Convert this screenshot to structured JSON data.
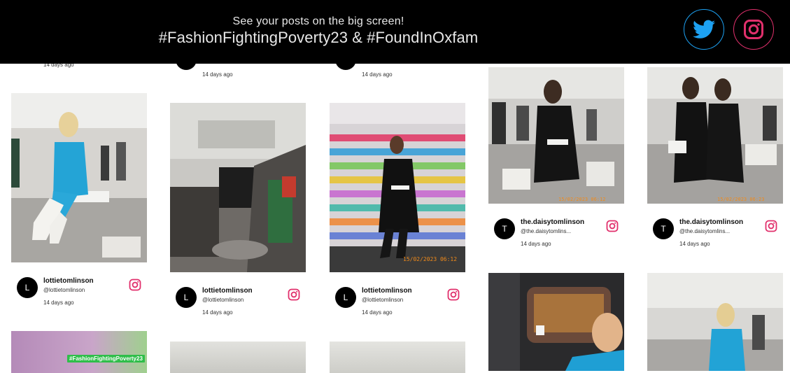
{
  "header": {
    "tagline": "See your posts on the big screen!",
    "hashtags": "#FashionFightingPoverty23 & #FoundInOxfam",
    "twitter_icon": "twitter-icon",
    "instagram_icon": "instagram-icon",
    "colors": {
      "twitter": "#1da1f2",
      "instagram": "#e1306c"
    }
  },
  "posts": {
    "c1_top": {
      "time": "14 days ago"
    },
    "c1_p1": {
      "avatar": "L",
      "username": "lottietomlinson",
      "handle": "@lottietomlinson",
      "time": "14 days ago"
    },
    "c1_p2": {
      "badge": "#FashionFightingPoverty23"
    },
    "c2_top": {
      "time": "14 days ago"
    },
    "c2_p1": {
      "avatar": "L",
      "username": "lottietomlinson",
      "handle": "@lottietomlinson",
      "time": "14 days ago"
    },
    "c3_top": {
      "time": "14 days ago"
    },
    "c3_p1": {
      "avatar": "L",
      "username": "lottietomlinson",
      "handle": "@lottietomlinson",
      "time": "14 days ago",
      "stamp": "15/02/2023 06:12"
    },
    "c4_p1": {
      "avatar": "T",
      "username": "the.daisytomlinson",
      "handle": "@the.daisytomlins...",
      "time": "14 days ago",
      "stamp": "15/02/2023 06:12"
    },
    "c5_p1": {
      "avatar": "T",
      "username": "the.daisytomlinson",
      "handle": "@the.daisytomlins...",
      "time": "14 days ago",
      "stamp": "15/02/2023 06:23"
    }
  },
  "icons": {
    "post_network": "instagram-icon"
  }
}
